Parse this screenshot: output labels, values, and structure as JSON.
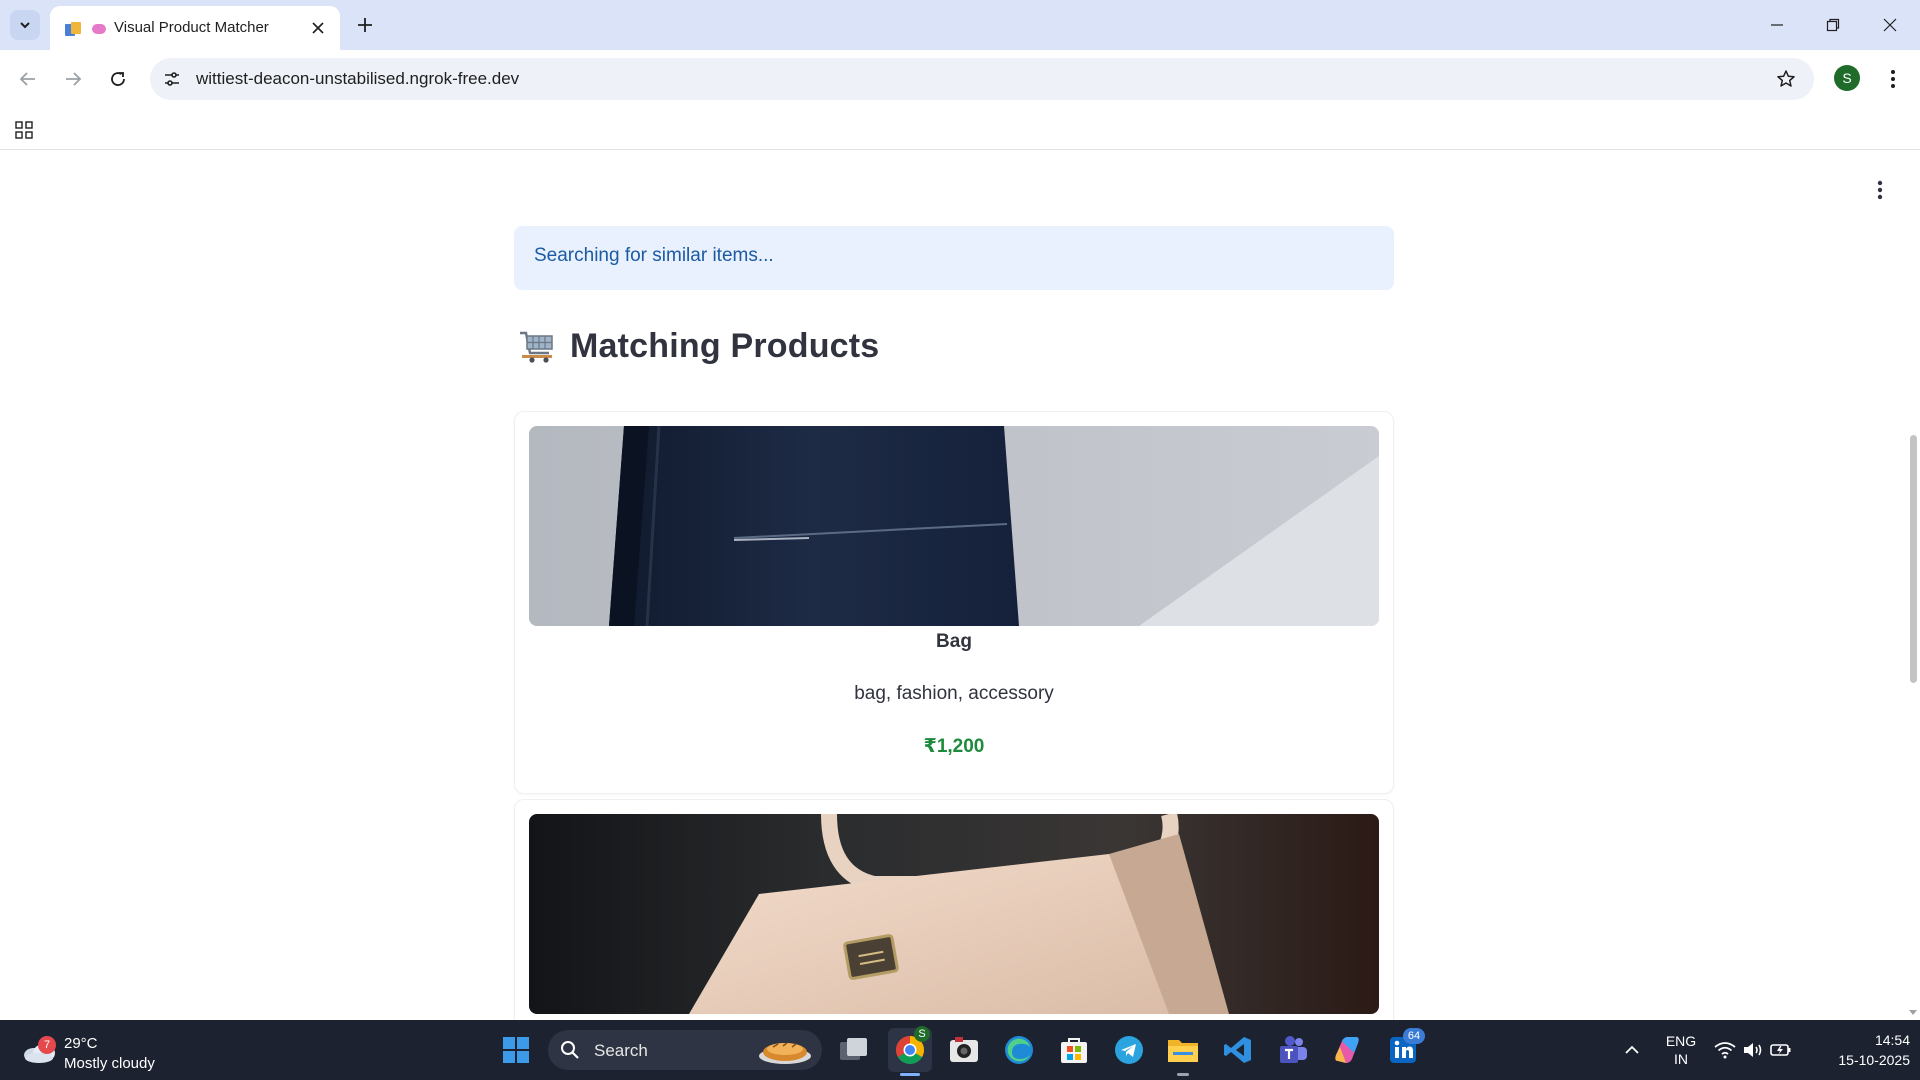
{
  "browser": {
    "tab_title": "Visual Product Matcher",
    "url": "wittiest-deacon-unstabilised.ngrok-free.dev",
    "profile_initial": "S"
  },
  "page": {
    "info_message": "Searching for similar items...",
    "heading": "Matching Products",
    "products": [
      {
        "name": "Bag",
        "tags": "bag, fashion, accessory",
        "price": "₹1,200"
      },
      {
        "name": "",
        "tags": "",
        "price": ""
      }
    ]
  },
  "taskbar": {
    "weather_badge": "7",
    "temperature": "29°C",
    "condition": "Mostly cloudy",
    "search_label": "Search",
    "chrome_badge": "S",
    "linkedin_badge": "64",
    "lang_line1": "ENG",
    "lang_line2": "IN",
    "time": "14:54",
    "date": "15-10-2025"
  },
  "colors": {
    "tabstrip": "#dae3f7",
    "info_bg": "#e8f1fd",
    "info_text": "#1c5aa3",
    "price_green": "#1e8a3c",
    "taskbar_bg": "#1c2230"
  }
}
